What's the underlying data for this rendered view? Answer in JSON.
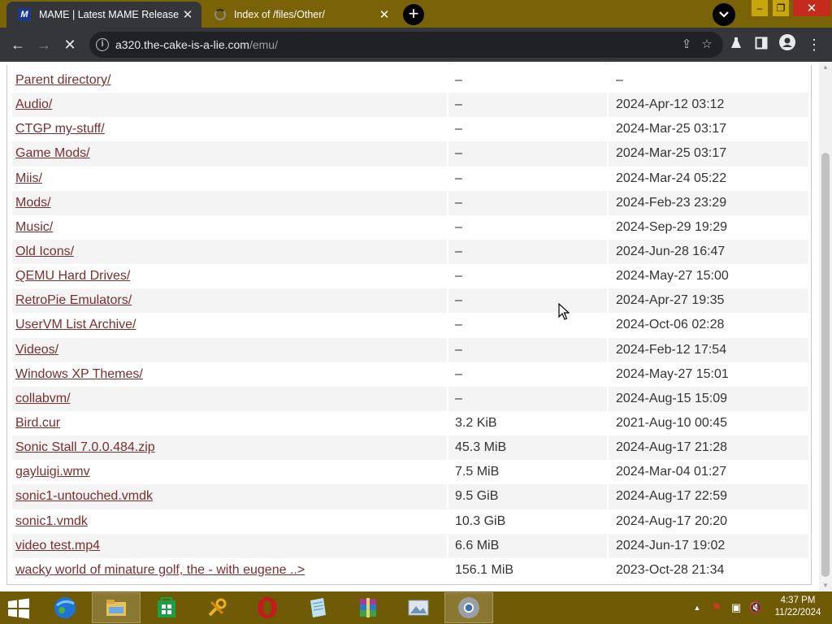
{
  "tabs": [
    {
      "title": "MAME | Latest MAME Release",
      "active": true,
      "favicon": "mame-logo-icon"
    },
    {
      "title": "Index of /files/Other/",
      "active": false,
      "favicon": "loading-spinner-icon"
    }
  ],
  "window_controls": {
    "minimize": "–",
    "maximize": "❐",
    "close": "✕"
  },
  "toolbar": {
    "url_host": "a320.the-cake-is-a-lie.com",
    "url_path": "/emu/",
    "back_icon": "←",
    "forward_icon": "→",
    "stop_icon": "✕",
    "info_icon": "i",
    "share_icon": "⇪",
    "star_icon": "☆",
    "menu_icon": "⋮"
  },
  "listing": [
    {
      "name": "Parent directory/",
      "size": "–",
      "date": "–"
    },
    {
      "name": "Audio/",
      "size": "–",
      "date": "2024-Apr-12 03:12"
    },
    {
      "name": "CTGP my-stuff/",
      "size": "–",
      "date": "2024-Mar-25 03:17"
    },
    {
      "name": "Game Mods/",
      "size": "–",
      "date": "2024-Mar-25 03:17"
    },
    {
      "name": "Miis/",
      "size": "–",
      "date": "2024-Mar-24 05:22"
    },
    {
      "name": "Mods/",
      "size": "–",
      "date": "2024-Feb-23 23:29"
    },
    {
      "name": "Music/",
      "size": "–",
      "date": "2024-Sep-29 19:29"
    },
    {
      "name": "Old Icons/",
      "size": "–",
      "date": "2024-Jun-28 16:47"
    },
    {
      "name": "QEMU Hard Drives/",
      "size": "–",
      "date": "2024-May-27 15:00"
    },
    {
      "name": "RetroPie Emulators/",
      "size": "–",
      "date": "2024-Apr-27 19:35"
    },
    {
      "name": "UserVM List Archive/",
      "size": "–",
      "date": "2024-Oct-06 02:28"
    },
    {
      "name": "Videos/",
      "size": "–",
      "date": "2024-Feb-12 17:54"
    },
    {
      "name": "Windows XP Themes/",
      "size": "–",
      "date": "2024-May-27 15:01"
    },
    {
      "name": "collabvm/",
      "size": "–",
      "date": "2024-Aug-15 15:09"
    },
    {
      "name": "Bird.cur",
      "size": "3.2 KiB",
      "date": "2021-Aug-10 00:45"
    },
    {
      "name": "Sonic Stall 7.0.0.484.zip",
      "size": "45.3 MiB",
      "date": "2024-Aug-17 21:28"
    },
    {
      "name": "gayluigi.wmv",
      "size": "7.5 MiB",
      "date": "2024-Mar-04 01:27"
    },
    {
      "name": "sonic1-untouched.vmdk",
      "size": "9.5 GiB",
      "date": "2024-Aug-17 22:59"
    },
    {
      "name": "sonic1.vmdk",
      "size": "10.3 GiB",
      "date": "2024-Aug-17 20:20"
    },
    {
      "name": "video test.mp4",
      "size": "6.6 MiB",
      "date": "2024-Jun-17 19:02"
    },
    {
      "name": "wacky world of minature golf, the - with eugene ..>",
      "size": "156.1 MiB",
      "date": "2023-Oct-28 21:34"
    }
  ],
  "taskbar": {
    "apps": [
      "internet-explorer-icon",
      "file-explorer-icon",
      "store-icon",
      "tools-icon",
      "opera-icon",
      "notepad-icon",
      "winrar-icon",
      "photo-viewer-icon",
      "chrome-icon"
    ],
    "clock_time": "4:37 PM",
    "clock_date": "11/22/2024"
  },
  "colors": {
    "titlebar": "#7a6306",
    "link": "#7a2e2e",
    "taskbar": "#6f5a05"
  }
}
